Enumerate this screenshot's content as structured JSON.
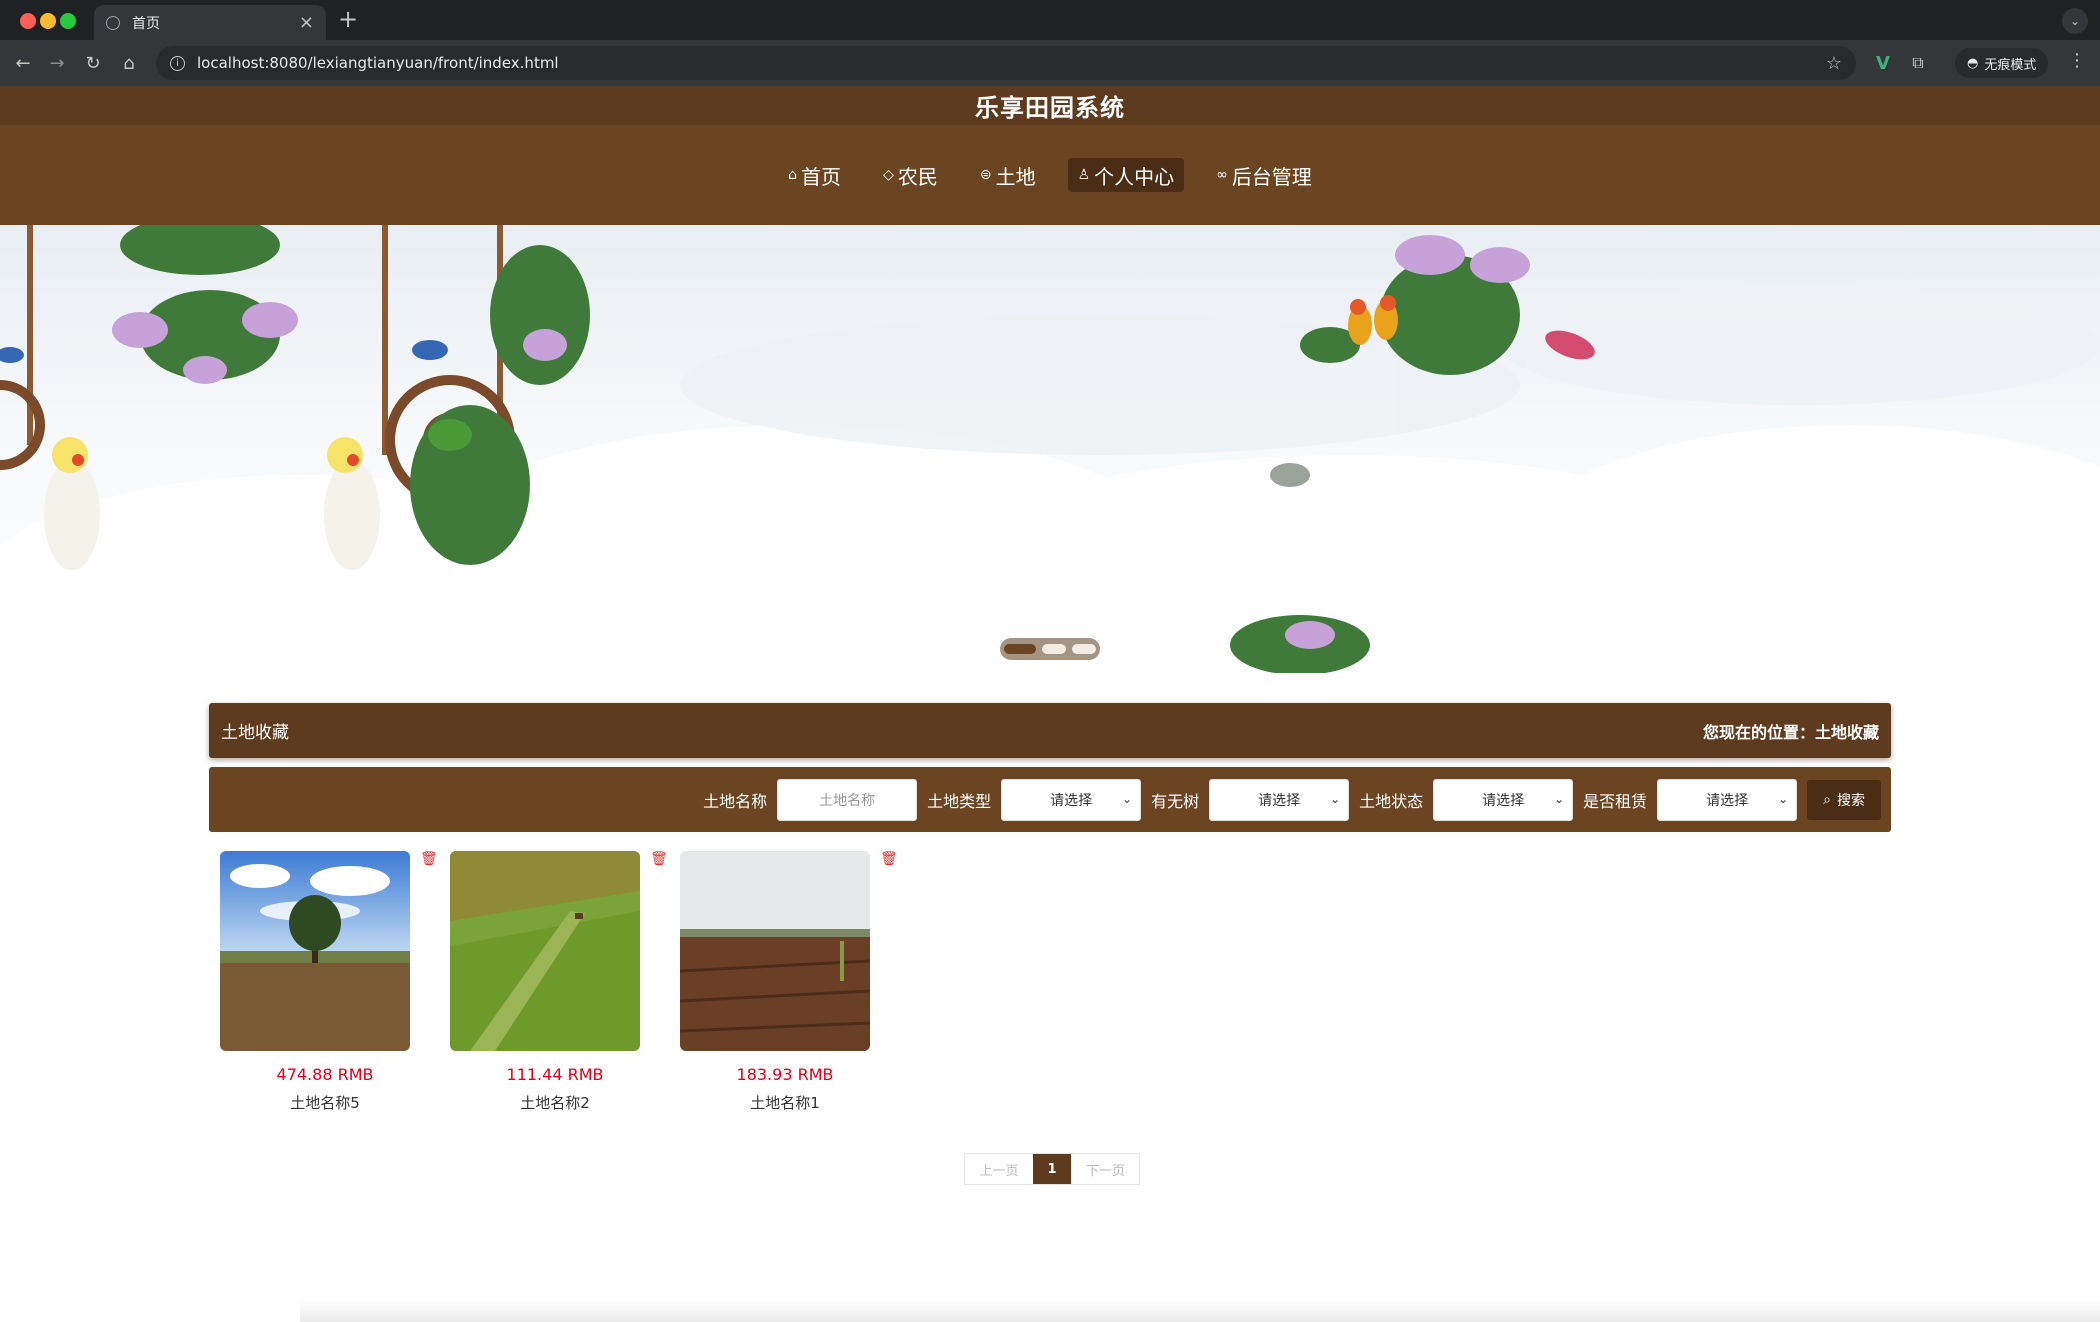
{
  "browser": {
    "tab_title": "首页",
    "new_tab": "+",
    "url": "localhost:8080/lexiangtianyuan/front/index.html",
    "incognito_label": "无痕模式"
  },
  "app": {
    "title": "乐享田园系统",
    "nav": [
      {
        "label": "首页",
        "icon": "home-icon"
      },
      {
        "label": "农民",
        "icon": "tag-icon"
      },
      {
        "label": "土地",
        "icon": "land-icon"
      },
      {
        "label": "个人中心",
        "icon": "user-icon"
      },
      {
        "label": "后台管理",
        "icon": "link-icon"
      }
    ],
    "active_nav": "个人中心"
  },
  "banner": {
    "slides": 3,
    "active_slide": 1
  },
  "section": {
    "title": "土地收藏",
    "location_label": "您现在的位置：土地收藏"
  },
  "search": {
    "name_label": "土地名称",
    "name_placeholder": "土地名称",
    "type_label": "土地类型",
    "tree_label": "有无树",
    "status_label": "土地状态",
    "rent_label": "是否租赁",
    "select_default": "请选择",
    "button": "搜索"
  },
  "cards": [
    {
      "price": "474.88 RMB",
      "name": "土地名称5"
    },
    {
      "price": "111.44 RMB",
      "name": "土地名称2"
    },
    {
      "price": "183.93 RMB",
      "name": "土地名称1"
    }
  ],
  "pager": {
    "prev": "上一页",
    "current": "1",
    "next": "下一页"
  },
  "colors": {
    "header_dark": "#5e3a1e",
    "nav_brown": "#6b4522",
    "active_brown": "#4a2d14",
    "price_red": "#e2001a"
  }
}
